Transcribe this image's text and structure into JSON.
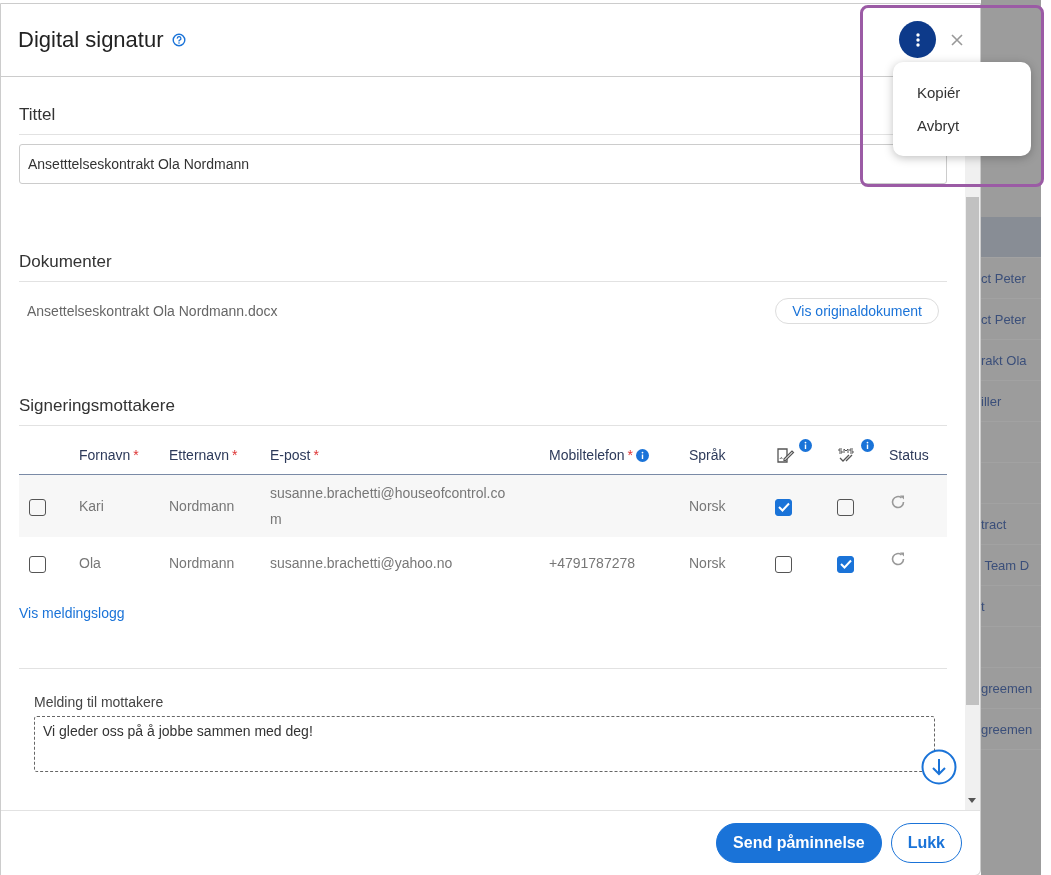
{
  "dialog": {
    "title": "Digital signatur",
    "menu": {
      "open": true,
      "items": [
        "Kopiér",
        "Avbryt"
      ],
      "highlighted": true
    },
    "title_section": {
      "heading": "Tittel",
      "value": "Ansetttelseskontrakt Ola Nordmann"
    },
    "documents": {
      "heading": "Dokumenter",
      "file": "Ansettelseskontrakt Ola Nordmann.docx",
      "button": "Vis originaldokument"
    },
    "recipients": {
      "heading": "Signeringsmottakere",
      "columns": [
        {
          "label": "Fornavn",
          "required_mark": "*",
          "info": false
        },
        {
          "label": "Etternavn",
          "required_mark": "*",
          "info": false
        },
        {
          "label": "E-post",
          "required_mark": "*",
          "info": false
        },
        {
          "label": "Mobiltelefon",
          "required_mark": "*",
          "info": true
        },
        {
          "label": "Språk",
          "info": false
        },
        {
          "kind": "sign-icon",
          "info": true
        },
        {
          "kind": "sms-icon",
          "info": true
        },
        {
          "label": "Status",
          "info": false
        }
      ],
      "rows": [
        {
          "checked": false,
          "first": "Kari",
          "last": "Nordmann",
          "email": "susanne.brachetti@houseofcontrol.co m",
          "language": "Norsk",
          "sign": true,
          "sms": false
        },
        {
          "checked": false,
          "first": "Ola",
          "last": "Nordmann",
          "email": "susanne.brachetti@yahoo.no",
          "phone": "+4791787278",
          "language": "Norsk",
          "sign": false,
          "sms": true
        }
      ],
      "log_link": "Vis meldingslogg"
    },
    "message": {
      "label": "Melding til mottakere",
      "value": "Vi gleder oss på å jobbe sammen med deg!"
    },
    "buttons": [
      {
        "label": "Send påminnelse",
        "primary": true
      },
      {
        "label": "Lukk",
        "primary": false
      }
    ]
  },
  "background_list": [
    {
      "kind": "header"
    },
    {
      "kind": "item",
      "text": "ct Peter"
    },
    {
      "kind": "item",
      "text": "ct Peter"
    },
    {
      "kind": "item",
      "text": "rakt Ola"
    },
    {
      "kind": "item",
      "text": "iller"
    },
    {
      "kind": "blank"
    },
    {
      "kind": "blank"
    },
    {
      "kind": "item",
      "text": "tract"
    },
    {
      "kind": "item",
      "text": " Team D"
    },
    {
      "kind": "item",
      "text": "t"
    },
    {
      "kind": "blank"
    },
    {
      "kind": "item",
      "text": "greemen"
    },
    {
      "kind": "item",
      "text": "greemen"
    }
  ]
}
